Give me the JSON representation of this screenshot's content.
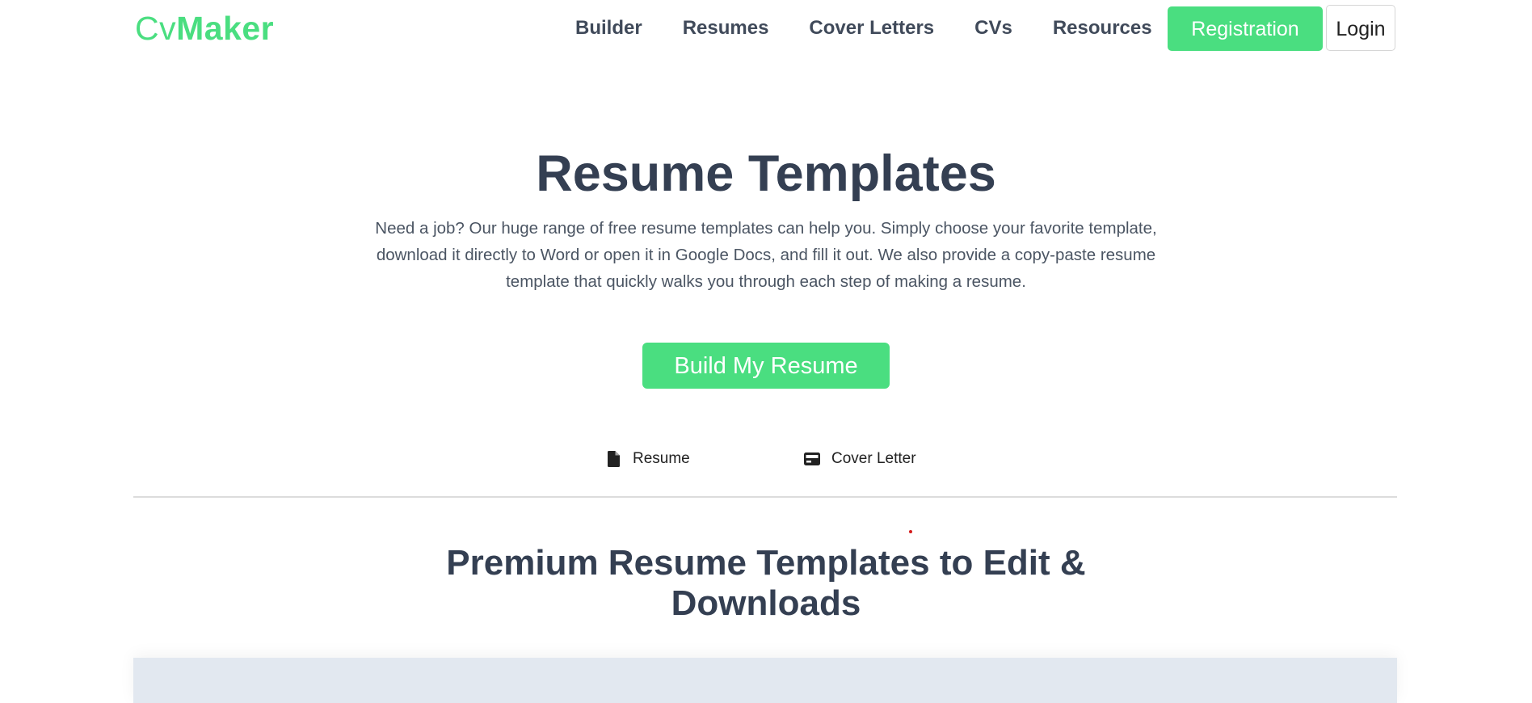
{
  "header": {
    "logo_part1": "Cv",
    "logo_part2": "Maker",
    "nav": [
      {
        "label": "Builder"
      },
      {
        "label": "Resumes"
      },
      {
        "label": "Cover Letters"
      },
      {
        "label": "CVs"
      },
      {
        "label": "Resources"
      }
    ],
    "registration_label": "Registration",
    "login_label": "Login"
  },
  "hero": {
    "title": "Resume Templates",
    "description": "Need a job? Our huge range of free resume templates can help you. Simply choose your favorite template, download it directly to Word or open it in Google Docs, and fill it out. We also provide a copy-paste resume template that quickly walks you through each step of making a resume.",
    "cta_label": "Build My Resume"
  },
  "tabs": [
    {
      "label": "Resume",
      "icon": "document-icon"
    },
    {
      "label": "Cover Letter",
      "icon": "card-icon"
    }
  ],
  "section": {
    "title": "Premium Resume Templates to Edit & Downloads"
  },
  "colors": {
    "brand_green": "#4ade80",
    "heading_text": "#343f52",
    "gallery_bg": "#e2e8f0"
  }
}
